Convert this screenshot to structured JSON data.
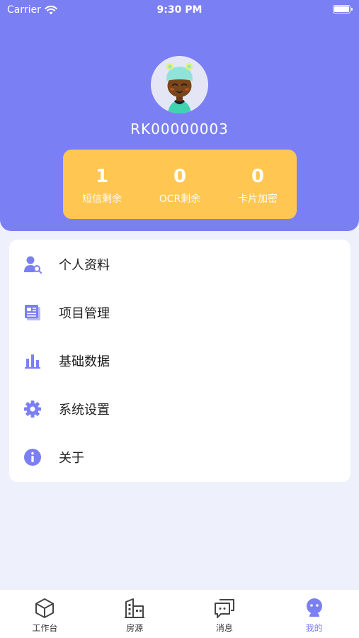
{
  "status_bar": {
    "carrier": "Carrier",
    "time": "9:30 PM"
  },
  "profile": {
    "username": "RK00000003"
  },
  "stats": [
    {
      "value": "1",
      "label": "短信剩余"
    },
    {
      "value": "0",
      "label": "OCR剩余"
    },
    {
      "value": "0",
      "label": "卡片加密"
    }
  ],
  "menu": [
    {
      "label": "个人资料",
      "icon": "user-search-icon"
    },
    {
      "label": "项目管理",
      "icon": "document-stack-icon"
    },
    {
      "label": "基础数据",
      "icon": "bar-chart-icon"
    },
    {
      "label": "系统设置",
      "icon": "gear-icon"
    },
    {
      "label": "关于",
      "icon": "info-icon"
    }
  ],
  "tabs": [
    {
      "label": "工作台",
      "icon": "cube-icon",
      "active": false
    },
    {
      "label": "房源",
      "icon": "building-icon",
      "active": false
    },
    {
      "label": "消息",
      "icon": "chat-icon",
      "active": false
    },
    {
      "label": "我的",
      "icon": "person-icon",
      "active": true
    }
  ],
  "colors": {
    "accent": "#7B7FF4",
    "stats_card": "#FFC652",
    "background": "#EEF1FC"
  }
}
